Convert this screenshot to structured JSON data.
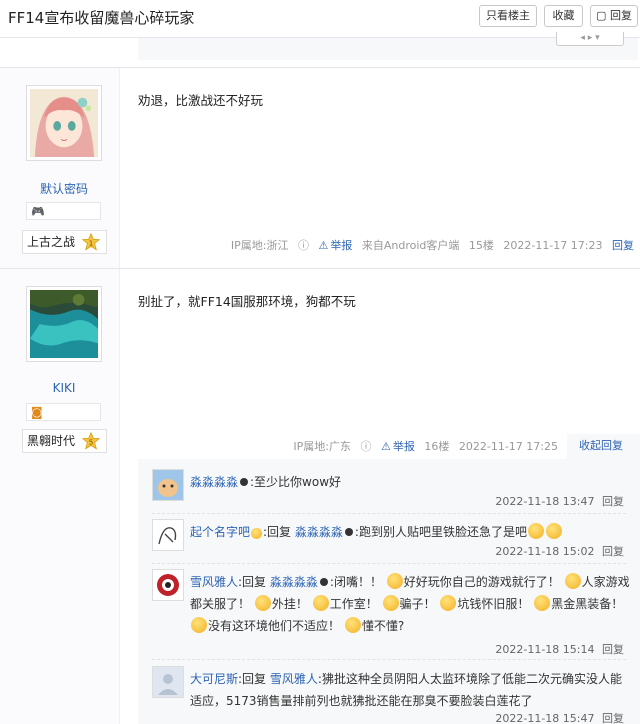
{
  "header": {
    "title": "FF14宣布收留魔兽心碎玩家",
    "only_author": "只看楼主",
    "favorite": "收藏",
    "reply": "回复"
  },
  "posts": [
    {
      "username": "默认密码",
      "level_name": "上古之战",
      "level_num": "1",
      "content": "劝退，比激战还不好玩",
      "ip": "IP属地:浙江",
      "report": "举报",
      "source": "来自Android客户端",
      "floor": "15楼",
      "time": "2022-11-17 17:23",
      "reply": "回复"
    },
    {
      "username": "KIKI",
      "level_name": "黑翱时代",
      "level_num": "5",
      "content": "别扯了，就FF14国服那环境，狗都不玩",
      "ip": "IP属地:广东",
      "report": "举报",
      "floor": "16楼",
      "time": "2022-11-17 17:25",
      "collapse": "收起回复"
    }
  ],
  "replies": [
    {
      "user": "淼淼淼淼",
      "text": ":至少比你wow好",
      "time": "2022-11-18 13:47",
      "reply": "回复"
    },
    {
      "user": "起个名字吧",
      "prefix": ":回复",
      "target": "淼淼淼淼",
      "text": ":跑到别人贴吧里铁脸还急了是吧",
      "time": "2022-11-18 15:02",
      "reply": "回复"
    },
    {
      "user": "雪风雅人",
      "prefix": ":回复",
      "target": "淼淼淼淼",
      "t1": ":闭嘴！！",
      "t2": "好好玩你自己的游戏就行了！",
      "t3": "人家游戏都关服了！",
      "t4": "外挂！",
      "t5": "工作室！",
      "t6": "骗子！",
      "t7": "坑钱怀旧服！",
      "t8": "黑金黑装备！",
      "t9": "没有这环境他们不适应！",
      "t10": "懂不懂?",
      "time": "2022-11-18 15:14",
      "reply": "回复"
    },
    {
      "user": "大可尼斯",
      "prefix": ":回复",
      "target": "雪风雅人",
      "text": ":狒批这种全员阴阳人太监环境除了低能二次元确实没人能适应，5173销售量排前列也就狒批还能在那臭不要脸装白莲花了",
      "time": "2022-11-18 15:47",
      "reply": "回复"
    }
  ],
  "colors": {
    "link": "#2d64b3",
    "muted": "#999999",
    "reply_bg": "#f7f8fa"
  }
}
